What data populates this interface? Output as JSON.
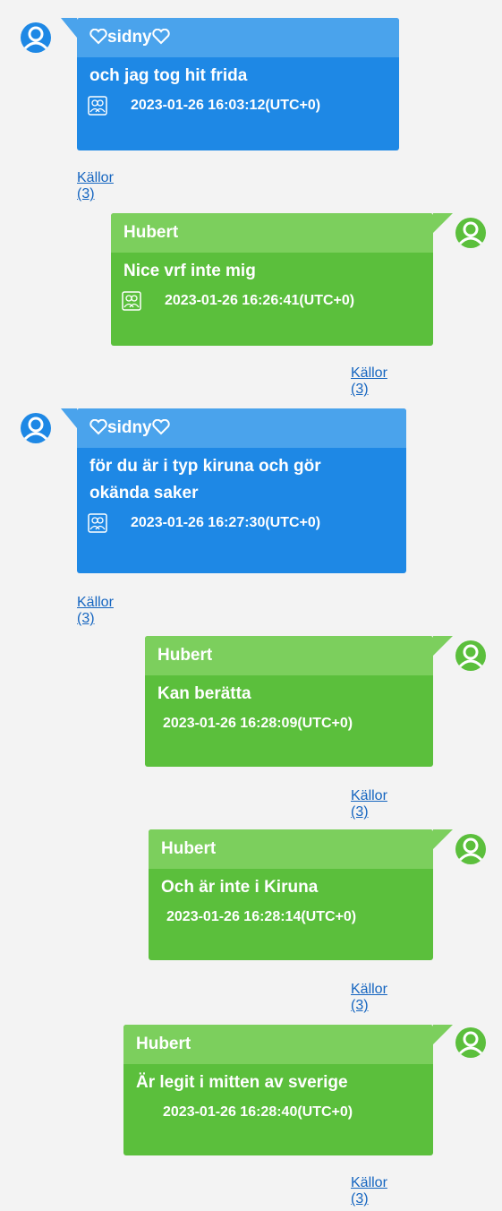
{
  "colors": {
    "sent_bubble": "#5bbf3c",
    "received_bubble": "#1e88e5",
    "link": "#1565c0"
  },
  "messages": [
    {
      "sender": "sidny",
      "text": "och jag tog hit frida",
      "timestamp": "2023-01-26 16:03:12(UTC+0)",
      "sources": "Källor (3)",
      "group_icon": "group-icon"
    },
    {
      "sender": "Hubert",
      "text": "Nice vrf inte mig",
      "timestamp": "2023-01-26 16:26:41(UTC+0)",
      "sources": "Källor (3)",
      "group_icon": "group-icon"
    },
    {
      "sender": "sidny",
      "text_line1": "för du är i typ kiruna och gör",
      "text_line2": "okända saker",
      "timestamp": "2023-01-26 16:27:30(UTC+0)",
      "sources": "Källor (3)",
      "group_icon": "group-icon"
    },
    {
      "sender": "Hubert",
      "text": "Kan berätta",
      "timestamp": "2023-01-26 16:28:09(UTC+0)",
      "sources": "Källor (3)"
    },
    {
      "sender": "Hubert",
      "text": "Och är inte i Kiruna",
      "timestamp": "2023-01-26 16:28:14(UTC+0)",
      "sources": "Källor (3)"
    },
    {
      "sender": "Hubert",
      "text": "Är legit i mitten av sverige",
      "timestamp": "2023-01-26 16:28:40(UTC+0)",
      "sources": "Källor (3)"
    }
  ]
}
